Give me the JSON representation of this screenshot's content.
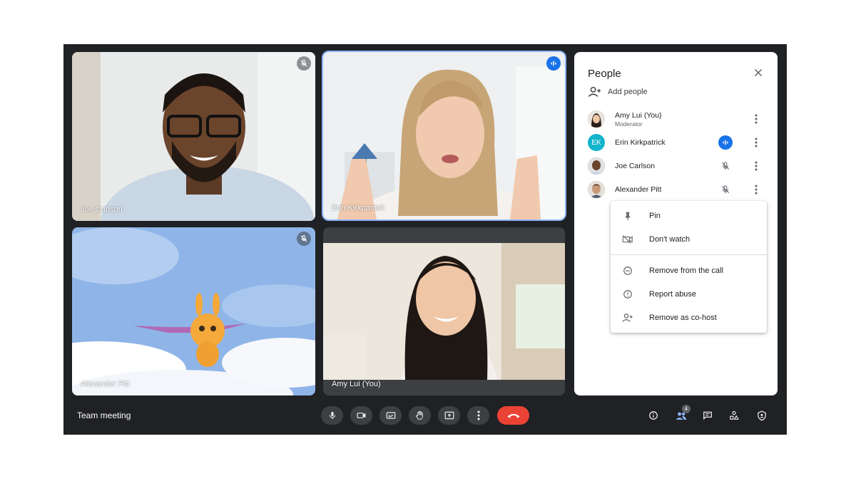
{
  "meeting": {
    "title": "Team meeting"
  },
  "tiles": [
    {
      "name": "Joe Carlson",
      "status": "muted"
    },
    {
      "name": "Erin Kirkpatrick",
      "status": "speaking"
    },
    {
      "name": "Alexander Pitt",
      "status": "muted"
    },
    {
      "name": "Amy Lui (You)",
      "status": "none"
    }
  ],
  "people_panel": {
    "title": "People",
    "add_people_label": "Add people",
    "participants": [
      {
        "name": "Amy Lui (You)",
        "role": "Moderator",
        "status": "none"
      },
      {
        "name": "Erin Kirkpatrick",
        "initials": "EK",
        "status": "speaking"
      },
      {
        "name": "Joe Carlson",
        "status": "muted"
      },
      {
        "name": "Alexander Pitt",
        "status": "muted"
      }
    ]
  },
  "context_menu": {
    "items": [
      {
        "label": "Pin",
        "icon": "pin-icon"
      },
      {
        "label": "Don't watch",
        "icon": "video-off-icon"
      },
      {
        "label": "Remove from the call",
        "icon": "remove-circle-icon"
      },
      {
        "label": "Report abuse",
        "icon": "report-icon"
      },
      {
        "label": "Remove as co-host",
        "icon": "person-add-icon"
      }
    ]
  },
  "controls": [
    {
      "icon": "mic-icon"
    },
    {
      "icon": "camera-icon"
    },
    {
      "icon": "captions-icon"
    },
    {
      "icon": "raise-hand-icon"
    },
    {
      "icon": "present-screen-icon"
    },
    {
      "icon": "more-options-icon"
    },
    {
      "icon": "end-call-icon"
    }
  ],
  "right_controls": {
    "people_count": "4",
    "icons": [
      "info-icon",
      "people-icon",
      "chat-icon",
      "activities-icon",
      "host-controls-icon"
    ]
  },
  "colors": {
    "background": "#202124",
    "accent_blue": "#1a73e8",
    "end_call_red": "#ea4335",
    "control_gray": "#3c4043",
    "avatar_teal": "#12b5cb"
  }
}
